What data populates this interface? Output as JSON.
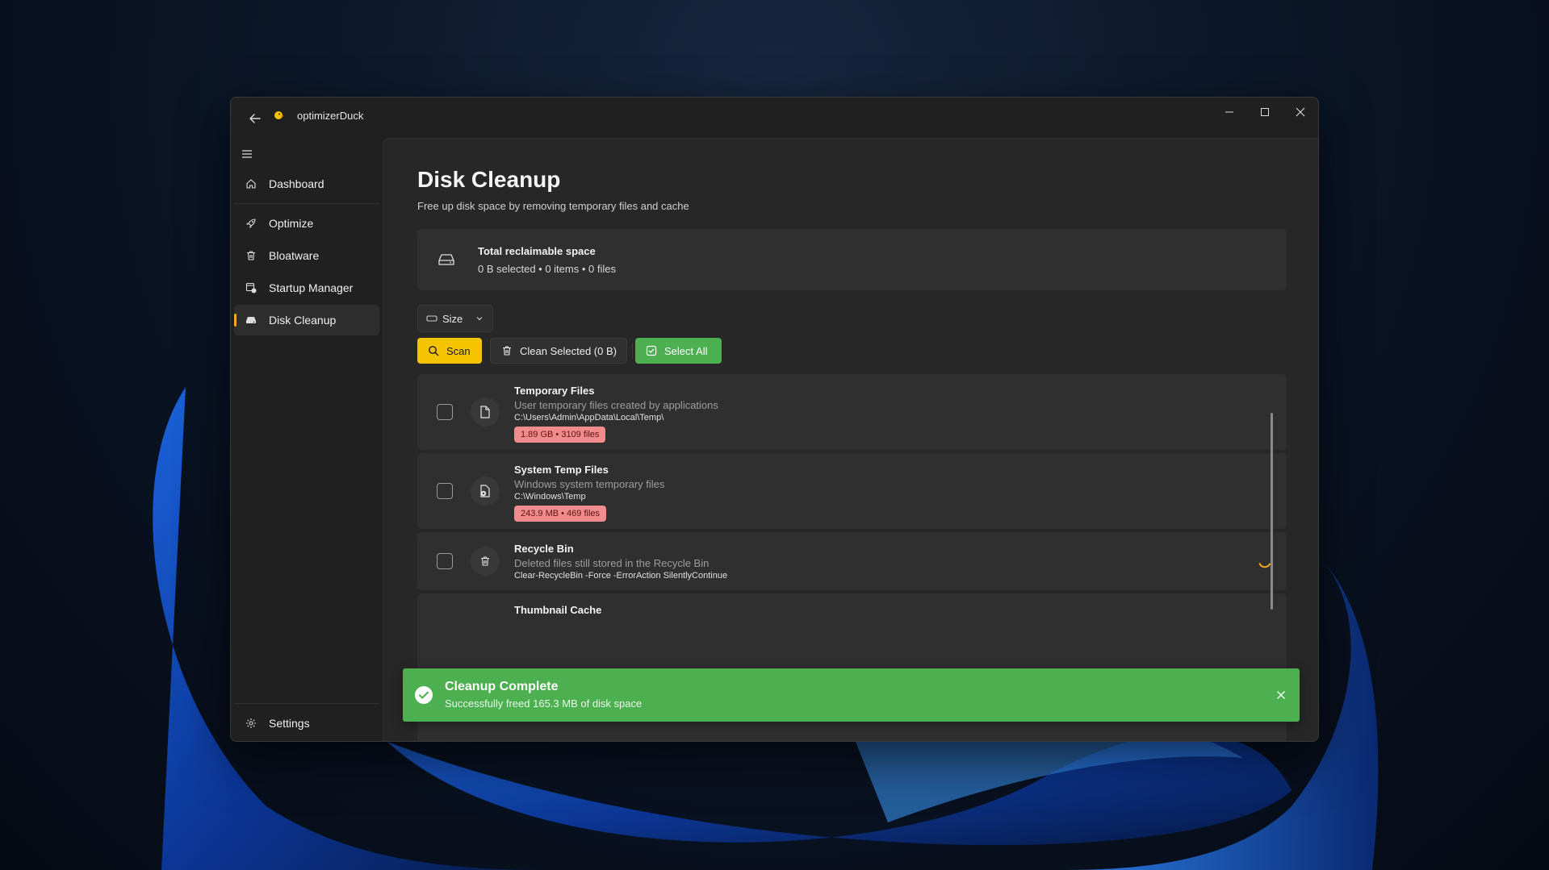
{
  "app": {
    "title": "optimizerDuck",
    "accent": "#f5a623"
  },
  "sidebar": {
    "items": [
      {
        "label": "Dashboard",
        "icon": "home-icon"
      },
      {
        "label": "Optimize",
        "icon": "rocket-icon"
      },
      {
        "label": "Bloatware",
        "icon": "trash-icon"
      },
      {
        "label": "Startup Manager",
        "icon": "startup-app-icon"
      },
      {
        "label": "Disk Cleanup",
        "icon": "drive-icon",
        "active": true
      }
    ],
    "settings_label": "Settings"
  },
  "page": {
    "title": "Disk Cleanup",
    "subtitle": "Free up disk space by removing temporary files and cache"
  },
  "summary": {
    "title": "Total reclaimable space",
    "detail": "0 B selected • 0 items • 0 files"
  },
  "sort": {
    "selected": "Size"
  },
  "toolbar": {
    "scan_label": "Scan",
    "clean_label": "Clean Selected (0 B)",
    "select_all_label": "Select All",
    "scan_color": "#f5c400",
    "select_all_color": "#4caf50"
  },
  "items": [
    {
      "title": "Temporary Files",
      "description": "User temporary files created by applications",
      "path": "C:\\Users\\Admin\\AppData\\Local\\Temp\\",
      "badge": "1.89 GB  •  3109 files",
      "checked": false
    },
    {
      "title": "System Temp Files",
      "description": "Windows system temporary files",
      "path": "C:\\Windows\\Temp",
      "badge": "243.9 MB  •  469 files",
      "checked": false
    },
    {
      "title": "Recycle Bin",
      "description": "Deleted files still stored in the Recycle Bin",
      "path": "Clear-RecycleBin -Force -ErrorAction SilentlyContinue",
      "loading": true,
      "checked": false
    },
    {
      "title": "Thumbnail Cache"
    }
  ],
  "toast": {
    "title": "Cleanup Complete",
    "message": "Successfully freed 165.3 MB of disk space",
    "color": "#4caf50"
  }
}
